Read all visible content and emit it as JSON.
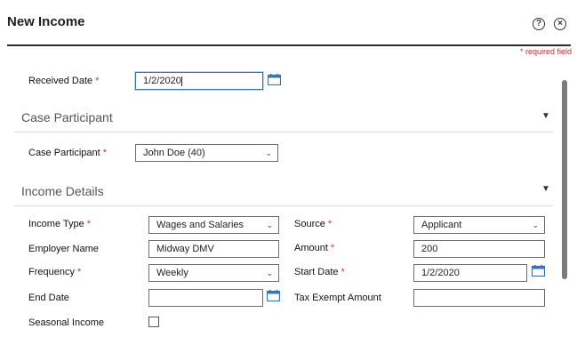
{
  "dialog": {
    "title": "New Income",
    "help_glyph": "?",
    "close_glyph": "×",
    "required_note": "* required field"
  },
  "received_date": {
    "label": "Received Date",
    "required_mark": "*",
    "value": "1/2/2020"
  },
  "case_participant_section": {
    "title": "Case Participant",
    "case_participant": {
      "label": "Case Participant",
      "required_mark": "*",
      "value": "John Doe (40)"
    }
  },
  "income_details_section": {
    "title": "Income Details",
    "income_type": {
      "label": "Income Type",
      "required_mark": "*",
      "value": "Wages and Salaries"
    },
    "source": {
      "label": "Source",
      "required_mark": "*",
      "value": "Applicant"
    },
    "employer_name": {
      "label": "Employer Name",
      "value": "Midway DMV"
    },
    "amount": {
      "label": "Amount",
      "required_mark": "*",
      "value": "200"
    },
    "frequency": {
      "label": "Frequency",
      "required_mark": "*",
      "value": "Weekly"
    },
    "start_date": {
      "label": "Start Date",
      "required_mark": "*",
      "value": "1/2/2020"
    },
    "end_date": {
      "label": "End Date",
      "value": ""
    },
    "tax_exempt_amount": {
      "label": "Tax Exempt Amount",
      "value": ""
    },
    "seasonal_income": {
      "label": "Seasonal Income",
      "checked": false
    }
  },
  "glyphs": {
    "chevron_down": "⌄",
    "collapse_triangle": "▼"
  },
  "icons": {
    "calendar": "calendar-icon",
    "help": "help-icon",
    "close": "close-icon"
  },
  "colors": {
    "accent": "#3a72b8",
    "required": "#c0392b",
    "divider": "#2b2b2b"
  }
}
